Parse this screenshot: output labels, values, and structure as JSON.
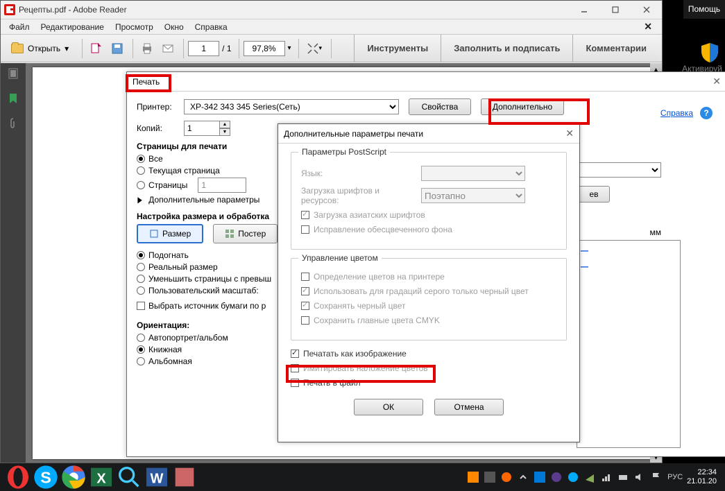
{
  "right_dark": {
    "help": "Помощь"
  },
  "titlebar": {
    "title": "Рецепты.pdf - Adobe Reader"
  },
  "menubar": {
    "file": "Файл",
    "edit": "Редактирование",
    "view": "Просмотр",
    "window": "Окно",
    "help": "Справка"
  },
  "toolbar": {
    "open": "Открыть",
    "page_current": "1",
    "page_total": "/ 1",
    "zoom": "97,8%",
    "tabs": {
      "tools": "Инструменты",
      "fillsign": "Заполнить и подписать",
      "comments": "Комментарии"
    }
  },
  "print": {
    "title": "Печать",
    "printer_label": "Принтер:",
    "printer_value": "XP-342 343 345 Series(Сеть)",
    "properties": "Свойства",
    "advanced": "Дополнительно",
    "copies_label": "Копий:",
    "copies_value": "1",
    "help": "Справка",
    "pages_section": "Страницы для печати",
    "all": "Все",
    "current": "Текущая страница",
    "pages": "Страницы",
    "pages_value": "1",
    "more_params": "Дополнительные параметры",
    "size_section": "Настройка размера и обработка",
    "tab_size": "Размер",
    "tab_poster": "Постер",
    "fit": "Подогнать",
    "actual": "Реальный размер",
    "shrink": "Уменьшить страницы с превыш",
    "custom": "Пользовательский масштаб:",
    "paper_source": "Выбрать источник бумаги по р",
    "orient_section": "Ориентация:",
    "auto": "Автопортрет/альбом",
    "portrait": "Книжная",
    "landscape": "Альбомная",
    "mm": "мм",
    "ev": "ев"
  },
  "adv": {
    "title": "Дополнительные параметры печати",
    "ps_group": "Параметры PostScript",
    "lang": "Язык:",
    "fonts": "Загрузка шрифтов и ресурсов:",
    "fonts_value": "Поэтапно",
    "asian": "Загрузка азиатских шрифтов",
    "bleach": "Исправление обесцвеченного фона",
    "color_group": "Управление цветом",
    "color_printer": "Определение цветов на принтере",
    "gray_black": "Использовать для градаций серого только черный цвет",
    "keep_black": "Сохранять черный цвет",
    "keep_cmyk": "Сохранить главные цвета CMYK",
    "as_image": "Печатать как изображение",
    "overprint": "Имитировать наложение цветов",
    "to_file": "Печать в файл",
    "ok": "ОК",
    "cancel": "Отмена"
  },
  "taskbar": {
    "lang_short": "РУС",
    "time": "22:34",
    "date": "21.01.20",
    "activate": "Активируй"
  }
}
